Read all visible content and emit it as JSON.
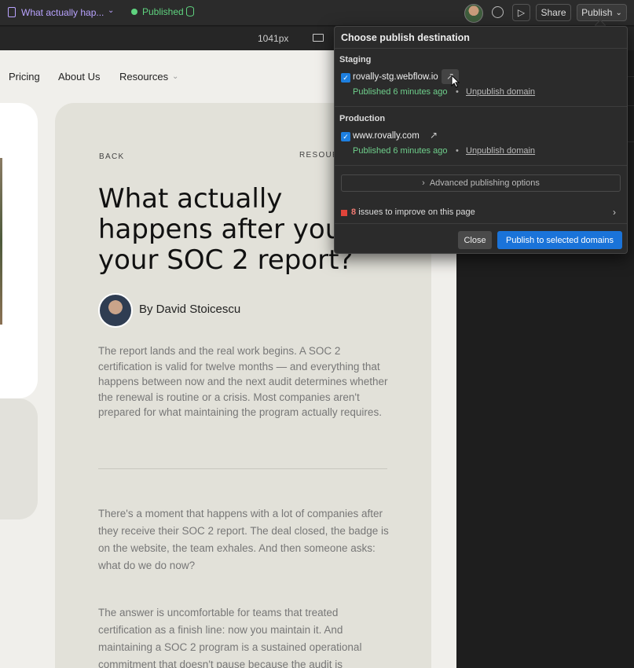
{
  "topbar": {
    "page_title": "What actually hap...",
    "status": "Published",
    "share_label": "Share",
    "publish_label": "Publish"
  },
  "subbar": {
    "viewport_size": "1041px"
  },
  "site_nav": {
    "links": [
      "Pricing",
      "About Us",
      "Resources"
    ]
  },
  "article": {
    "back_label": "BACK",
    "category_label": "RESOUR",
    "title": "What actually happens after you your SOC 2 report?",
    "author": "By David Stoicescu",
    "intro": "The report lands and the real work begins. A SOC 2 certification is valid for twelve months — and everything that happens between now and the next audit determines whether the renewal is routine or a crisis. Most companies aren't prepared for what maintaining the program actually requires.",
    "para1": "There's a moment that happens with a lot of companies after they receive their SOC 2 report. The deal closed, the badge is on the website, the team exhales. And then someone asks: what do we do now?",
    "para2": "The answer is uncomfortable for teams that treated certification as a finish line: now you maintain it. And maintaining a SOC 2 program is a sustained operational commitment that doesn't pause because the audit is"
  },
  "publish_popover": {
    "title": "Choose publish destination",
    "staging": {
      "label": "Staging",
      "domain": "rovally-stg.webflow.io",
      "published_note": "Published 6 minutes ago",
      "unpublish_label": "Unpublish domain"
    },
    "production": {
      "label": "Production",
      "domain": "www.rovally.com",
      "published_note": "Published 6 minutes ago",
      "unpublish_label": "Unpublish domain"
    },
    "advanced_label": "Advanced publishing options",
    "issues_count": "8",
    "issues_text": "issues to improve on this page",
    "close_label": "Close",
    "publish_selected_label": "Publish to selected domains"
  },
  "colors": {
    "accent_blue": "#1a73d9",
    "published_green": "#5fd37f",
    "issue_red": "#e0443a",
    "page_title_purple": "#b9a3ff"
  }
}
